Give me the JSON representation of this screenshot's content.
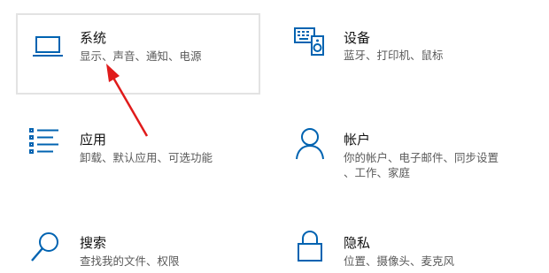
{
  "accent_color": "#0063b1",
  "arrow_color": "#e01b1b",
  "tiles": [
    {
      "id": "system",
      "icon": "laptop-icon",
      "title": "系统",
      "desc": [
        "显示、声音、通知、电源"
      ],
      "selected": true
    },
    {
      "id": "devices",
      "icon": "keyboard-speaker-icon",
      "title": "设备",
      "desc": [
        "蓝牙、打印机、鼠标"
      ]
    },
    {
      "id": "apps",
      "icon": "app-list-icon",
      "title": "应用",
      "desc": [
        "卸载、默认应用、可选功能"
      ]
    },
    {
      "id": "accounts",
      "icon": "person-icon",
      "title": "帐户",
      "desc": [
        "你的帐户、电子邮件、同步设置",
        "、工作、家庭"
      ]
    },
    {
      "id": "search",
      "icon": "magnifier-icon",
      "title": "搜索",
      "desc": [
        "查找我的文件、权限"
      ]
    },
    {
      "id": "privacy",
      "icon": "lock-icon",
      "title": "隐私",
      "desc": [
        "位置、摄像头、麦克风"
      ]
    }
  ]
}
